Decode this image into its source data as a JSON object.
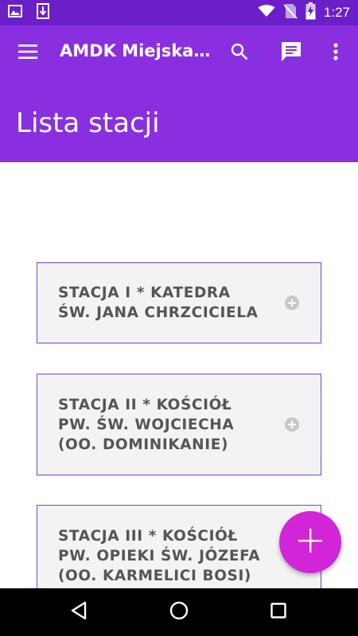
{
  "status_bar": {
    "time": "1:27",
    "battery_level": "charging",
    "icons": [
      "image-icon",
      "download-icon",
      "wifi-icon",
      "no-sim-icon",
      "battery-icon"
    ]
  },
  "app_bar": {
    "title": "AMDK Miejska…",
    "page_title": "Lista stacji",
    "icons": [
      "menu-icon",
      "search-icon",
      "chat-icon",
      "more-vert-icon"
    ]
  },
  "stations": [
    {
      "label": "STACJA I * KATEDRA\nŚW. JANA CHRZCICIELA",
      "icon": "add-circle-icon"
    },
    {
      "label": "STACJA II * KOŚCIÓŁ\nPW. ŚW. WOJCIECHA\n(OO. DOMINIKANIE)",
      "icon": "add-circle-icon"
    },
    {
      "label": "STACJA III * KOŚCIÓŁ\nPW. OPIEKI ŚW. JÓZEFA\n(OO. KARMELICI BOSI)",
      "icon": "add-circle-icon"
    }
  ],
  "fab": {
    "icon": "plus-icon"
  },
  "nav_bar": {
    "icons": [
      "back-icon",
      "home-icon",
      "recents-icon"
    ]
  },
  "colors": {
    "status_bar": "#6a1fc8",
    "app_bar": "#8a2fe0",
    "card_border": "#7d3fd6",
    "card_bg": "#f3f3f3",
    "card_text": "#555555",
    "fab": "#d325d8",
    "nav_bar": "#000000"
  }
}
